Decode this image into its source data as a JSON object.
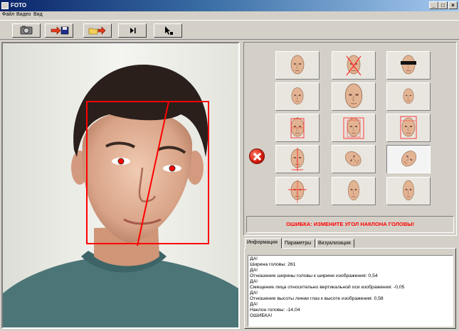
{
  "window": {
    "title": "FOTO",
    "minimize": "_",
    "maximize": "□",
    "close": "×"
  },
  "menu": [
    "Файл",
    "Видео",
    "Вид"
  ],
  "toolbar": [
    "camera-icon",
    "arrow-save-icon",
    "open-arrow-icon",
    "play-step-icon",
    "cursor-icon"
  ],
  "status": "ОШИБКА: ИЗМЕНИТЕ УГОЛ НАКЛОНА ГОЛОВЫ!",
  "tabs": [
    "Информация",
    "Параметры",
    "Визуализация"
  ],
  "log": [
    "ДА!",
    "Ширина головы: 261",
    "ДА!",
    "Отношение ширины головы к ширине изображения: 0,54",
    "ДА!",
    "Смещение лица относительно вертикальной оси изображения: -0,05",
    "ДА!",
    "Отношение высоты линии глаз к высоте изображения: 0,58",
    "ДА!",
    "Наклон головы: -14,04",
    "ОШИБКА!"
  ],
  "head_grid": [
    [
      "head-front-icon",
      "head-crossed-icon",
      "head-eyes-masked-icon"
    ],
    [
      "head-small-icon",
      "head-large-icon",
      "head-smaller-icon"
    ],
    [
      "head-width-frame-icon",
      "head-frame-wide-icon",
      "head-frame-high-icon"
    ],
    [
      "head-vertical-axis-icon",
      "head-tilted-right-icon",
      "head-tilted-left-icon"
    ],
    [
      "head-eye-line-icon",
      "head-turned-right-icon",
      "head-turned-left-icon"
    ]
  ]
}
